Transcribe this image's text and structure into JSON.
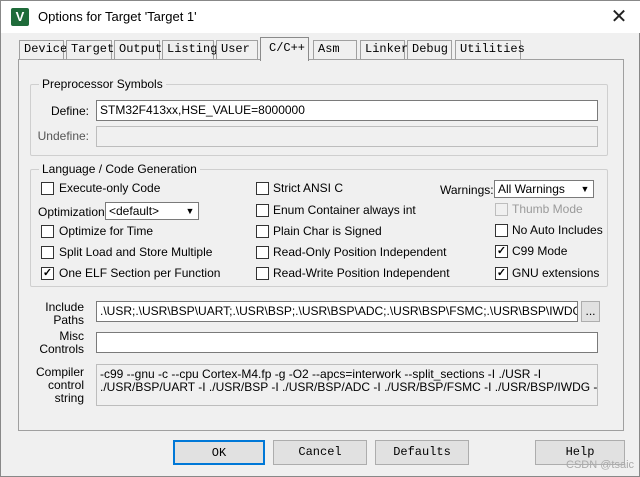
{
  "window": {
    "title": "Options for Target 'Target 1'",
    "close_glyph": "✕",
    "app_icon_letter": "V"
  },
  "tabs": [
    {
      "label": "Device"
    },
    {
      "label": "Target"
    },
    {
      "label": "Output"
    },
    {
      "label": "Listing"
    },
    {
      "label": "User"
    },
    {
      "label": "C/C++"
    },
    {
      "label": "Asm"
    },
    {
      "label": "Linker"
    },
    {
      "label": "Debug"
    },
    {
      "label": "Utilities"
    }
  ],
  "active_tab": "C/C++",
  "preprocessor": {
    "group_title": "Preprocessor Symbols",
    "define_label": "Define:",
    "define_value": "STM32F413xx,HSE_VALUE=8000000",
    "undefine_label": "Undefine:",
    "undefine_value": ""
  },
  "language": {
    "group_title": "Language / Code Generation",
    "execute_only": {
      "label": "Execute-only Code",
      "checked": false
    },
    "optimization_label": "Optimization:",
    "optimization_value": "<default>",
    "optimize_time": {
      "label": "Optimize for Time",
      "checked": false
    },
    "split_load": {
      "label": "Split Load and Store Multiple",
      "checked": false
    },
    "one_elf": {
      "label": "One ELF Section per Function",
      "checked": true,
      "check_glyph": "✓"
    },
    "strict_ansi": {
      "label": "Strict ANSI C",
      "checked": false
    },
    "enum_container": {
      "label": "Enum Container always int",
      "checked": false
    },
    "plain_char": {
      "label": "Plain Char is Signed",
      "checked": false
    },
    "ro_pi": {
      "label": "Read-Only Position Independent",
      "checked": false
    },
    "rw_pi": {
      "label": "Read-Write Position Independent",
      "checked": false
    },
    "warnings_label": "Warnings:",
    "warnings_value": "All Warnings",
    "thumb_mode": {
      "label": "Thumb Mode",
      "checked": false,
      "disabled": true
    },
    "no_auto_includes": {
      "label": "No Auto Includes",
      "checked": false
    },
    "c99_mode": {
      "label": "C99 Mode",
      "checked": true,
      "check_glyph": "✓"
    },
    "gnu_extensions": {
      "label": "GNU extensions",
      "checked": true,
      "check_glyph": "✓"
    }
  },
  "include": {
    "label_line1": "Include",
    "label_line2": "Paths",
    "value": ".\\USR;.\\USR\\BSP\\UART;.\\USR\\BSP;.\\USR\\BSP\\ADC;.\\USR\\BSP\\FSMC;.\\USR\\BSP\\IWDG;.\\U",
    "browse_label": "..."
  },
  "misc": {
    "label_line1": "Misc",
    "label_line2": "Controls",
    "value": ""
  },
  "compiler": {
    "label_line1": "Compiler",
    "label_line2": "control",
    "label_line3": "string",
    "line1": "-c99 --gnu -c --cpu Cortex-M4.fp -g -O2 --apcs=interwork --split_sections -I ./USR -I",
    "line2": "./USR/BSP/UART -I ./USR/BSP -I ./USR/BSP/ADC -I ./USR/BSP/FSMC -I ./USR/BSP/IWDG -I"
  },
  "buttons": {
    "ok": "OK",
    "cancel": "Cancel",
    "defaults": "Defaults",
    "help": "Help"
  },
  "watermark": "CSDN @tsaic",
  "colors": {
    "title_bg": "#ffffff",
    "dialog_bg": "#f0f0f0",
    "default_button_border": "#0078d7"
  }
}
